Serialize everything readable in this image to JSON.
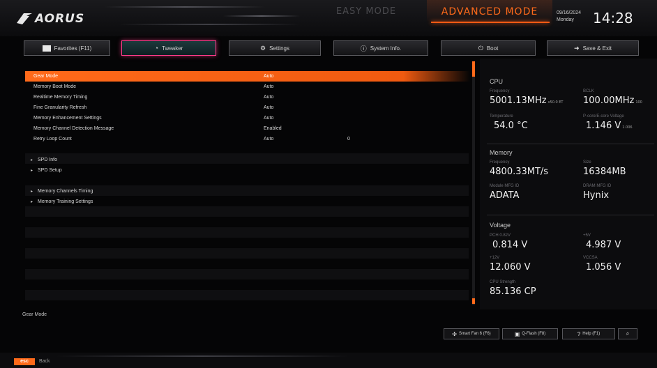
{
  "header": {
    "brand": "AORUS",
    "mode_easy": "EASY MODE",
    "mode_advanced": "ADVANCED MODE",
    "date": "09/16/2024",
    "weekday": "Monday",
    "time": "14:28"
  },
  "tabs": [
    {
      "label": "Favorites (F11)",
      "icon": "star-icon",
      "active": false
    },
    {
      "label": "Tweaker",
      "icon": "gauge-icon",
      "active": true
    },
    {
      "label": "Settings",
      "icon": "gear-icon",
      "active": false
    },
    {
      "label": "System Info.",
      "icon": "info-icon",
      "active": false
    },
    {
      "label": "Boot",
      "icon": "power-icon",
      "active": false
    },
    {
      "label": "Save & Exit",
      "icon": "exit-icon",
      "active": false
    }
  ],
  "settings": [
    {
      "label": "Gear Mode",
      "value": "Auto",
      "selected": true
    },
    {
      "label": "Memory Boot Mode",
      "value": "Auto"
    },
    {
      "label": "Realtime Memory Timing",
      "value": "Auto"
    },
    {
      "label": "Fine Granularity Refresh",
      "value": "Auto"
    },
    {
      "label": "Memory Enhancement Settings",
      "value": "Auto"
    },
    {
      "label": "Memory Channel Detection Message",
      "value": "Enabled"
    },
    {
      "label": "Retry Loop Count",
      "value": "Auto",
      "extra": "0"
    }
  ],
  "submenus": [
    {
      "label": "SPD Info"
    },
    {
      "label": "SPD Setup"
    },
    {
      "label": "Memory Channels Timing"
    },
    {
      "label": "Memory Training Settings"
    }
  ],
  "info": {
    "cpu": {
      "title": "CPU",
      "frequency_label": "Frequency",
      "frequency": "5001.13MHz",
      "frequency_sub": "x50.0 ET",
      "bclk_label": "BCLK",
      "bclk": "100.00MHz",
      "bclk_sub": "100",
      "temp_label": "Temperature",
      "temp": "54.0 °C",
      "voltage_label": "P-core/E-core Voltage",
      "voltage": "1.146 V",
      "voltage_sub": "1.006"
    },
    "memory": {
      "title": "Memory",
      "frequency_label": "Frequency",
      "frequency": "4800.33MT/s",
      "size_label": "Size",
      "size": "16384MB",
      "module_label": "Module MFG ID",
      "module": "ADATA",
      "dram_label": "DRAM MFG ID",
      "dram": "Hynix"
    },
    "voltage": {
      "title": "Voltage",
      "pch_label": "PCH 0.82V",
      "pch": "0.814 V",
      "v5_label": "+5V",
      "v5": "4.987 V",
      "v12_label": "+12V",
      "v12": "12.060 V",
      "vccsa_label": "VCCSA",
      "vccsa": "1.056 V",
      "strength_label": "CPU Strength",
      "strength": "85.136 CP"
    }
  },
  "help_text": "Gear Mode",
  "buttons": {
    "smartfan": "Smart Fan 6 (F6)",
    "qflash": "Q-Flash (F8)",
    "help": "Help (F1)"
  },
  "footer": {
    "esc": "esc",
    "back": "Back"
  }
}
